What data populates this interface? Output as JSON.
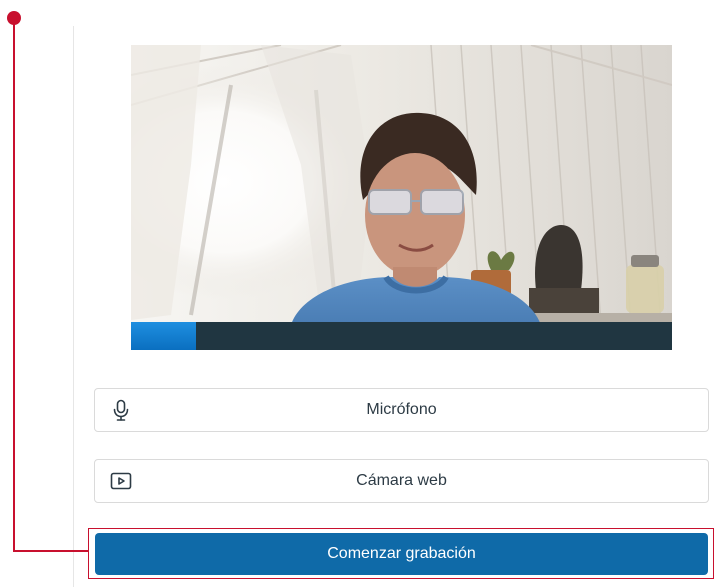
{
  "recorder": {
    "audio_level_fraction": 0.12,
    "level_fill_color": "#1d8ae0",
    "level_track_color": "#203641"
  },
  "devices": {
    "microphone": {
      "label": "Micrófono",
      "icon": "microphone-icon"
    },
    "webcam": {
      "label": "Cámara web",
      "icon": "video-play-icon"
    }
  },
  "actions": {
    "start_recording_label": "Comenzar grabación",
    "primary_color": "#0f6aa8"
  },
  "annotation": {
    "highlight_color": "#c8102e"
  }
}
